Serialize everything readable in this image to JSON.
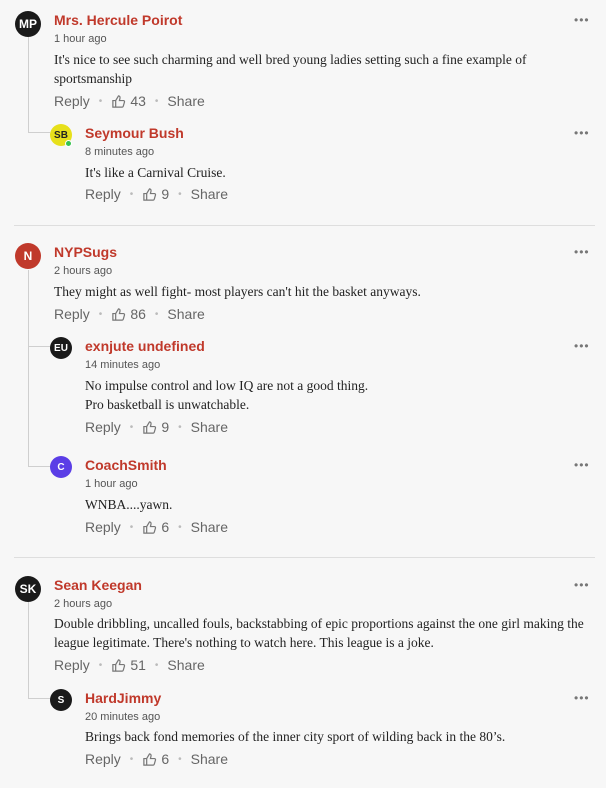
{
  "comments": [
    {
      "initials": "MP",
      "avatar_color": "#1a1a1a",
      "author": "Mrs. Hercule Poirot",
      "time": "1 hour ago",
      "text": "It's nice to see such charming and well bred young ladies setting such a fine example of sportsmanship",
      "reply": "Reply",
      "likes": "43",
      "share": "Share",
      "more": "•••"
    },
    {
      "initials": "SB",
      "avatar_color": "#e7e01b",
      "author": "Seymour Bush",
      "time": "8 minutes ago",
      "text": "It's like a Carnival Cruise.",
      "reply": "Reply",
      "likes": "9",
      "share": "Share",
      "more": "•••"
    },
    {
      "initials": "N",
      "avatar_color": "#c0392b",
      "author": "NYPSugs",
      "time": "2 hours ago",
      "text": "They might as well fight- most players can't hit the basket anyways.",
      "reply": "Reply",
      "likes": "86",
      "share": "Share",
      "more": "•••"
    },
    {
      "initials": "EU",
      "avatar_color": "#1a1a1a",
      "author": "exnjute undefined",
      "time": "14 minutes ago",
      "text": "No impulse control and low IQ are not a good thing.\n Pro basketball is unwatchable.",
      "reply": "Reply",
      "likes": "9",
      "share": "Share",
      "more": "•••"
    },
    {
      "initials": "C",
      "avatar_color": "#5b3ee6",
      "author": "CoachSmith",
      "time": "1 hour ago",
      "text": "WNBA....yawn.",
      "reply": "Reply",
      "likes": "6",
      "share": "Share",
      "more": "•••"
    },
    {
      "initials": "SK",
      "avatar_color": "#1a1a1a",
      "author": "Sean Keegan",
      "time": "2 hours ago",
      "text": "Double dribbling, uncalled fouls, backstabbing of epic proportions against the one girl making the league legitimate. There's nothing to watch here. This league is a joke.",
      "reply": "Reply",
      "likes": "51",
      "share": "Share",
      "more": "•••"
    },
    {
      "initials": "S",
      "avatar_color": "#1a1a1a",
      "author": "HardJimmy",
      "time": "20 minutes ago",
      "text": "Brings back fond memories of the inner city sport of wilding back in the 80’s.",
      "reply": "Reply",
      "likes": "6",
      "share": "Share",
      "more": "•••"
    }
  ],
  "colors": {
    "author": "#c0392b",
    "online": "#36c250"
  },
  "icons": {
    "like": "thumbs-up-icon",
    "more": "more-options-icon"
  }
}
